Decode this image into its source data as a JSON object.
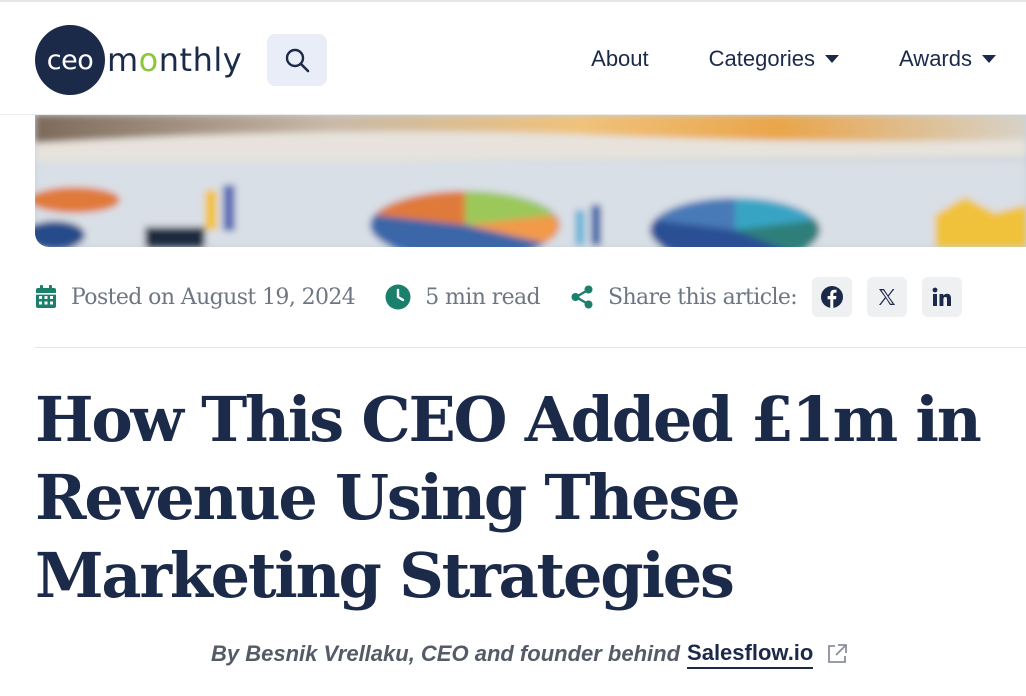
{
  "header": {
    "logo": {
      "prefix": "ceo",
      "rest_before": "m",
      "accent_letter": "o",
      "rest_after": "nthly"
    },
    "search_icon": "search-icon",
    "nav": [
      {
        "label": "About",
        "has_dropdown": false
      },
      {
        "label": "Categories",
        "has_dropdown": true
      },
      {
        "label": "Awards",
        "has_dropdown": true
      }
    ]
  },
  "meta": {
    "posted": "Posted on August 19, 2024",
    "read_time": "5 min read",
    "share_label": "Share this article:",
    "share_icons": [
      "facebook-icon",
      "x-icon",
      "linkedin-icon"
    ]
  },
  "article": {
    "title": "How This CEO Added £1m in Revenue Using These Marketing Strategies",
    "byline_prefix": "By Besnik Vrellaku, CEO and founder behind",
    "byline_link": "Salesflow.io"
  },
  "colors": {
    "navy": "#1c2a4a",
    "accent_green": "#8cc63f",
    "teal_icon": "#1a7f6b",
    "muted_text": "#6f7683",
    "search_bg": "#e9edf8"
  }
}
